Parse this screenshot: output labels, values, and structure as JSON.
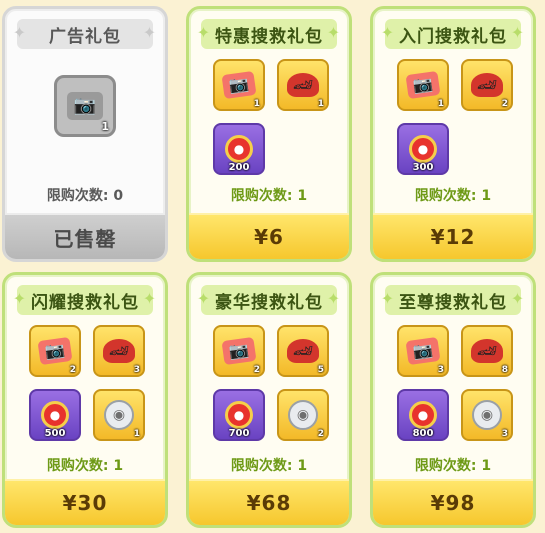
{
  "limit_label": "限购次数:",
  "packs": [
    {
      "title": "广告礼包",
      "limit_value": "0",
      "price": "已售罄",
      "sold_out": true,
      "items": [
        {
          "icon": "camera-card-gray-icon",
          "qty": "1",
          "frame": "gray"
        }
      ]
    },
    {
      "title": "特惠搜救礼包",
      "limit_value": "1",
      "price": "¥6",
      "sold_out": false,
      "items": [
        {
          "icon": "camera-card-icon",
          "qty": "1",
          "frame": "gold"
        },
        {
          "icon": "race-car-icon",
          "qty": "1",
          "frame": "gold"
        },
        {
          "icon": "apple-coin-icon",
          "qty": "200",
          "frame": "purple"
        }
      ]
    },
    {
      "title": "入门搜救礼包",
      "limit_value": "1",
      "price": "¥12",
      "sold_out": false,
      "items": [
        {
          "icon": "camera-card-icon",
          "qty": "1",
          "frame": "gold"
        },
        {
          "icon": "race-car-icon",
          "qty": "2",
          "frame": "gold"
        },
        {
          "icon": "apple-coin-icon",
          "qty": "300",
          "frame": "purple"
        }
      ]
    },
    {
      "title": "闪耀搜救礼包",
      "limit_value": "1",
      "price": "¥30",
      "sold_out": false,
      "items": [
        {
          "icon": "camera-card-icon",
          "qty": "2",
          "frame": "gold"
        },
        {
          "icon": "race-car-icon",
          "qty": "3",
          "frame": "gold"
        },
        {
          "icon": "apple-coin-icon",
          "qty": "500",
          "frame": "purple"
        },
        {
          "icon": "drone-robot-icon",
          "qty": "1",
          "frame": "gold"
        }
      ]
    },
    {
      "title": "豪华搜救礼包",
      "limit_value": "1",
      "price": "¥68",
      "sold_out": false,
      "items": [
        {
          "icon": "camera-card-icon",
          "qty": "2",
          "frame": "gold"
        },
        {
          "icon": "race-car-icon",
          "qty": "5",
          "frame": "gold"
        },
        {
          "icon": "apple-coin-icon",
          "qty": "700",
          "frame": "purple"
        },
        {
          "icon": "drone-robot-icon",
          "qty": "2",
          "frame": "gold"
        }
      ]
    },
    {
      "title": "至尊搜救礼包",
      "limit_value": "1",
      "price": "¥98",
      "sold_out": false,
      "items": [
        {
          "icon": "camera-card-icon",
          "qty": "3",
          "frame": "gold"
        },
        {
          "icon": "race-car-icon",
          "qty": "8",
          "frame": "gold"
        },
        {
          "icon": "apple-coin-icon",
          "qty": "800",
          "frame": "purple"
        },
        {
          "icon": "drone-robot-icon",
          "qty": "3",
          "frame": "gold"
        }
      ]
    }
  ]
}
